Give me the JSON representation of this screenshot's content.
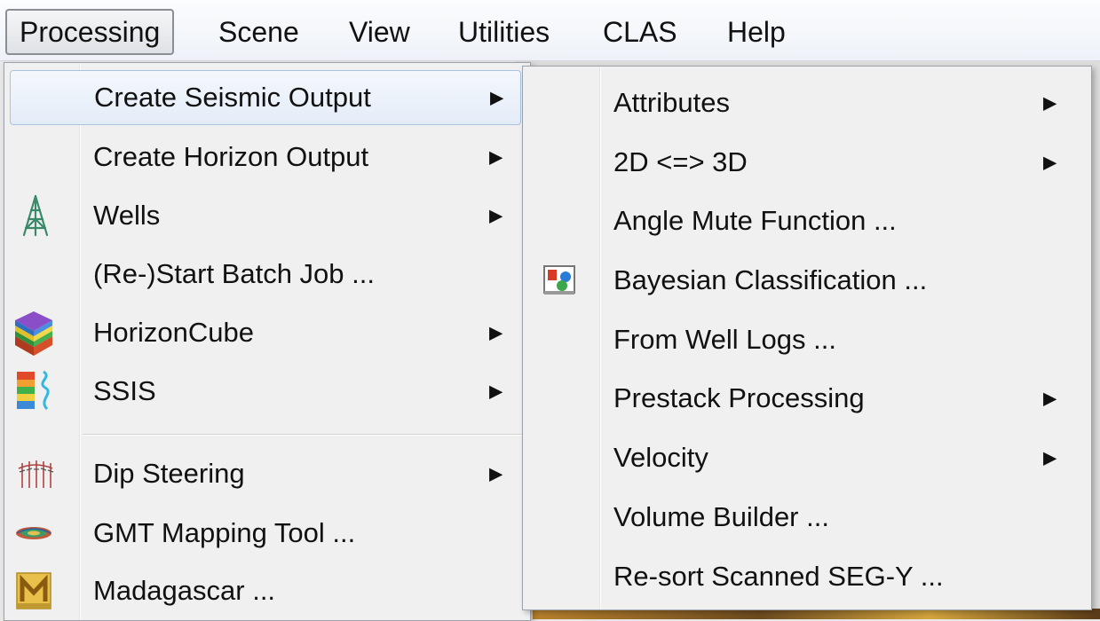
{
  "menubar": {
    "items": [
      {
        "label": "Processing",
        "active": true
      },
      {
        "label": "Scene"
      },
      {
        "label": "View"
      },
      {
        "label": "Utilities"
      },
      {
        "label": "CLAS"
      },
      {
        "label": "Help"
      }
    ]
  },
  "processing_menu": {
    "items": [
      {
        "label": "Create Seismic Output",
        "submenu": true,
        "highlighted": true,
        "icon": null
      },
      {
        "label": "Create Horizon Output",
        "submenu": true,
        "icon": null
      },
      {
        "label": "Wells",
        "submenu": true,
        "icon": "well-derrick-icon"
      },
      {
        "label": "(Re-)Start Batch Job ...",
        "submenu": false,
        "icon": null
      },
      {
        "label": "HorizonCube",
        "submenu": true,
        "icon": "horizoncube-icon"
      },
      {
        "label": "SSIS",
        "submenu": true,
        "icon": "ssis-icon"
      },
      {
        "label": "Dip Steering",
        "submenu": true,
        "icon": "dip-steering-icon"
      },
      {
        "label": "GMT Mapping Tool ...",
        "submenu": false,
        "icon": "gmt-icon"
      },
      {
        "label": "Madagascar ...",
        "submenu": false,
        "icon": "madagascar-icon"
      }
    ]
  },
  "seismic_output_submenu": {
    "items": [
      {
        "label": "Attributes",
        "submenu": true,
        "icon": null
      },
      {
        "label": "2D <=> 3D",
        "submenu": true,
        "icon": null
      },
      {
        "label": "Angle Mute Function ...",
        "submenu": false,
        "icon": null
      },
      {
        "label": "Bayesian Classification ...",
        "submenu": false,
        "icon": "bayesian-classification-icon"
      },
      {
        "label": "From Well Logs ...",
        "submenu": false,
        "icon": null
      },
      {
        "label": "Prestack Processing",
        "submenu": true,
        "icon": null
      },
      {
        "label": "Velocity",
        "submenu": true,
        "icon": null
      },
      {
        "label": "Volume Builder ...",
        "submenu": false,
        "icon": null
      },
      {
        "label": "Re-sort Scanned SEG-Y ...",
        "submenu": false,
        "icon": null
      }
    ]
  },
  "arrow_glyph": "▶",
  "colors": {
    "highlight_border": "#a9c2e2",
    "menu_bg": "#f0f0f0",
    "menubar_bg": "#eef2f8"
  }
}
